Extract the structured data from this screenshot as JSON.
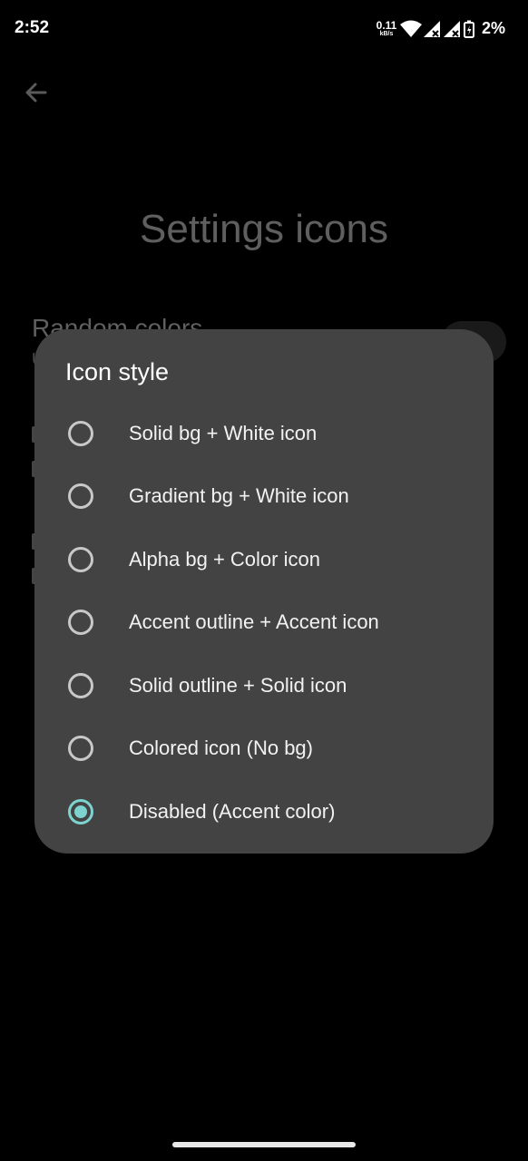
{
  "status_bar": {
    "time": "2:52",
    "net_speed": "0.11",
    "net_unit": "kB/s",
    "battery_percent": "2%",
    "icons": [
      "wifi-icon",
      "signal-icon",
      "signal-icon",
      "battery-icon"
    ]
  },
  "background_page": {
    "title": "Settings icons",
    "setting_title": "Random colors",
    "setting_subtitle": "U"
  },
  "dialog": {
    "title": "Icon style",
    "selected_index": 6,
    "accent_color": "#7dd3cf",
    "options": [
      {
        "label": "Solid bg + White icon"
      },
      {
        "label": "Gradient bg + White icon"
      },
      {
        "label": "Alpha bg + Color icon"
      },
      {
        "label": "Accent outline + Accent icon"
      },
      {
        "label": "Solid outline + Solid icon"
      },
      {
        "label": "Colored icon (No bg)"
      },
      {
        "label": "Disabled (Accent color)"
      }
    ]
  }
}
